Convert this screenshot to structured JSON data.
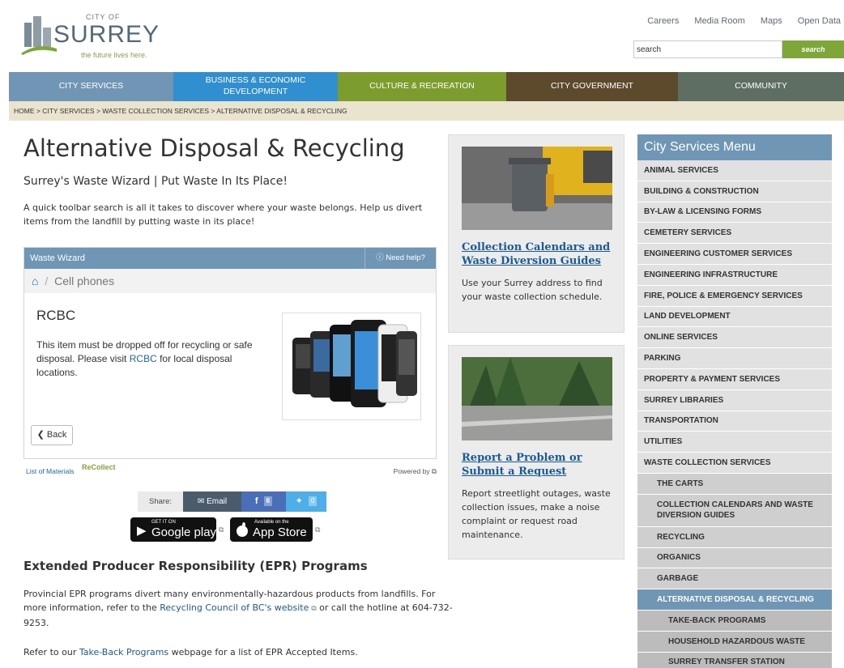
{
  "header": {
    "logo": {
      "city_of": "CITY OF",
      "wordmark": "SURREY",
      "tagline": "the future lives here."
    },
    "top_links": [
      "Careers",
      "Media Room",
      "Maps",
      "Open Data"
    ],
    "search": {
      "value": "search",
      "button": "search"
    }
  },
  "nav": [
    {
      "label": "CITY SERVICES",
      "color": "#7195b4"
    },
    {
      "label": "BUSINESS & ECONOMIC DEVELOPMENT",
      "color": "#2f8fd0"
    },
    {
      "label": "CULTURE & RECREATION",
      "color": "#7c9c2e"
    },
    {
      "label": "CITY GOVERNMENT",
      "color": "#5d4a2c"
    },
    {
      "label": "COMMUNITY",
      "color": "#5e6e63"
    }
  ],
  "breadcrumb": {
    "home": "HOME",
    "city_services": "CITY SERVICES",
    "waste_collection": "WASTE COLLECTION SERVICES",
    "current": "ALTERNATIVE DISPOSAL & RECYCLING",
    "separator": " > "
  },
  "main": {
    "title": "Alternative Disposal & Recycling",
    "subtitle": "Surrey's Waste Wizard | Put Waste In Its Place!",
    "intro": "A quick toolbar search is all it takes to discover where your waste belongs. Help us divert items from the landfill by putting waste in its place!",
    "wizard": {
      "header": "Waste Wizard",
      "help": "Need help?",
      "crumb_sep": "/",
      "crumb": "Cell phones",
      "item_title": "RCBC",
      "text_before": "This item must be dropped off for recycling or safe disposal. Please visit ",
      "link": "RCBC",
      "text_after": " for local disposal locations.",
      "back": "Back",
      "list_of_materials": "List of Materials",
      "recollect": "ReCollect",
      "powered_by": "Powered by"
    },
    "share": {
      "label": "Share:",
      "email": "Email",
      "facebook_count": "6",
      "twitter_count": "0"
    },
    "google_play": {
      "small": "GET IT ON",
      "big": "Google play"
    },
    "app_store": {
      "small": "Available on the",
      "big": "App Store"
    },
    "epr": {
      "heading": "Extended Producer Responsibility (EPR) Programs",
      "text_before": "Provincial EPR programs divert many environmentally-hazardous products from landfills. For more information, refer to the ",
      "link": "Recycling Council of BC's website",
      "text_after": " or call the hotline at 604-732-9253."
    },
    "refer": {
      "before": "Refer to our ",
      "link": "Take-Back Programs",
      "after": " webpage for a list of EPR Accepted Items."
    }
  },
  "cards": [
    {
      "title": "Collection Calendars and Waste Diversion Guides",
      "text": "Use your Surrey address to find your waste collection schedule."
    },
    {
      "title": "Report a Problem or Submit a Request",
      "text": "Report streetlight outages, waste collection issues, make a noise complaint or request road maintenance."
    }
  ],
  "sidebar": {
    "title": "City Services Menu",
    "items": [
      {
        "label": "ANIMAL SERVICES",
        "level": 1
      },
      {
        "label": "BUILDING & CONSTRUCTION",
        "level": 1
      },
      {
        "label": "BY-LAW & LICENSING FORMS",
        "level": 1
      },
      {
        "label": "CEMETERY SERVICES",
        "level": 1
      },
      {
        "label": "ENGINEERING CUSTOMER SERVICES",
        "level": 1
      },
      {
        "label": "ENGINEERING INFRASTRUCTURE",
        "level": 1
      },
      {
        "label": "FIRE, POLICE & EMERGENCY SERVICES",
        "level": 1
      },
      {
        "label": "LAND DEVELOPMENT",
        "level": 1
      },
      {
        "label": "ONLINE SERVICES",
        "level": 1
      },
      {
        "label": "PARKING",
        "level": 1
      },
      {
        "label": "PROPERTY & PAYMENT SERVICES",
        "level": 1
      },
      {
        "label": "SURREY LIBRARIES",
        "level": 1
      },
      {
        "label": "TRANSPORTATION",
        "level": 1
      },
      {
        "label": "UTILITIES",
        "level": 1
      },
      {
        "label": "WASTE COLLECTION SERVICES",
        "level": 1
      },
      {
        "label": "THE CARTS",
        "level": 2
      },
      {
        "label": "COLLECTION CALENDARS AND WASTE DIVERSION GUIDES",
        "level": 2
      },
      {
        "label": "RECYCLING",
        "level": 2
      },
      {
        "label": "ORGANICS",
        "level": 2
      },
      {
        "label": "GARBAGE",
        "level": 2
      },
      {
        "label": "ALTERNATIVE DISPOSAL & RECYCLING",
        "level": 2,
        "active": true
      },
      {
        "label": "TAKE-BACK PROGRAMS",
        "level": 3
      },
      {
        "label": "HOUSEHOLD HAZARDOUS WASTE",
        "level": 3
      },
      {
        "label": "SURREY TRANSFER STATION",
        "level": 3
      }
    ]
  }
}
